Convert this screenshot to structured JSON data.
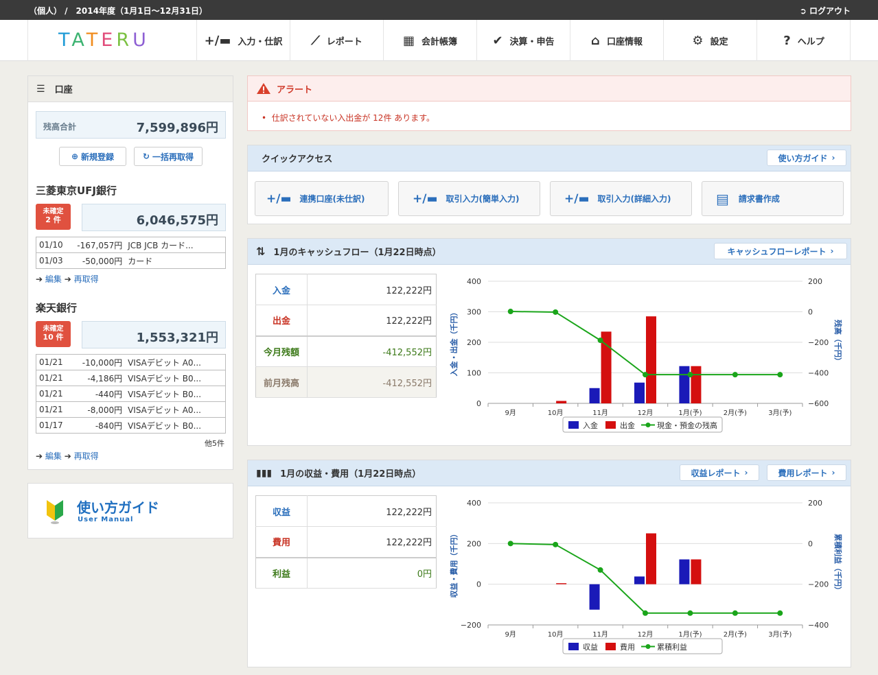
{
  "topbar": {
    "context": "（個人） /　2014年度（1月1日〜12月31日）",
    "logout": "ログアウト"
  },
  "logo": "TATERU",
  "nav": [
    {
      "label": "入力・仕訳",
      "icon": "entry-icon"
    },
    {
      "label": "レポート",
      "icon": "chart-line-icon"
    },
    {
      "label": "会計帳簿",
      "icon": "ledger-grid-icon"
    },
    {
      "label": "決算・申告",
      "icon": "check-icon"
    },
    {
      "label": "口座情報",
      "icon": "home-icon"
    },
    {
      "label": "設定",
      "icon": "gear-icon"
    },
    {
      "label": "ヘルプ",
      "icon": "question-icon"
    }
  ],
  "accounts": {
    "title": "口座",
    "total_label": "残高合計",
    "total_value": "7,599,896円",
    "new_btn": "新規登録",
    "refetch_all_btn": "一括再取得",
    "banks": [
      {
        "name": "三菱東京UFJ銀行",
        "badge_line1": "未確定",
        "badge_line2": "2 件",
        "balance": "6,046,575円",
        "rows": [
          [
            "01/10",
            "-167,057円",
            "JCB JCB カード..."
          ],
          [
            "01/03",
            "-50,000円",
            "カード"
          ]
        ],
        "more": "",
        "edit": "編集",
        "refetch": "再取得"
      },
      {
        "name": "楽天銀行",
        "badge_line1": "未確定",
        "badge_line2": "10 件",
        "balance": "1,553,321円",
        "rows": [
          [
            "01/21",
            "-10,000円",
            "VISAデビット A0..."
          ],
          [
            "01/21",
            "-4,186円",
            "VISAデビット B0..."
          ],
          [
            "01/21",
            "-440円",
            "VISAデビット B0..."
          ],
          [
            "01/21",
            "-8,000円",
            "VISAデビット A0..."
          ],
          [
            "01/17",
            "-840円",
            "VISAデビット B0..."
          ]
        ],
        "more": "他5件",
        "edit": "編集",
        "refetch": "再取得"
      }
    ]
  },
  "guide": {
    "title": "使い方ガイド",
    "subtitle": "User Manual"
  },
  "alert": {
    "title": "アラート",
    "message": "仕訳されていない入出金が 12件 あります。"
  },
  "quick": {
    "title": "クイックアクセス",
    "guide_btn": "使い方ガイド",
    "buttons": [
      "連携口座(未仕訳)",
      "取引入力(簡単入力)",
      "取引入力(詳細入力)",
      "請求書作成"
    ]
  },
  "cashflow": {
    "title": "1月のキャッシュフロー（1月22日時点）",
    "report_btn": "キャッシュフローレポート",
    "rows": [
      {
        "label": "入金",
        "value": "122,222円"
      },
      {
        "label": "出金",
        "value": "122,222円"
      },
      {
        "label": "今月残額",
        "value": "-412,552円"
      },
      {
        "label": "前月残高",
        "value": "-412,552円"
      }
    ]
  },
  "pl": {
    "title": "1月の収益・費用（1月22日時点）",
    "revenue_btn": "収益レポート",
    "expense_btn": "費用レポート",
    "rows": [
      {
        "label": "収益",
        "value": "122,222円"
      },
      {
        "label": "費用",
        "value": "122,222円"
      },
      {
        "label": "利益",
        "value": "0円"
      }
    ]
  },
  "colors": {
    "blue": "#1a1ab8",
    "red": "#d40f0f",
    "green": "#1aa51a",
    "link": "#2a6ebb"
  },
  "chart_data": [
    {
      "type": "bar",
      "categories": [
        "9月",
        "10月",
        "11月",
        "12月",
        "1月(予)",
        "2月(予)",
        "3月(予)"
      ],
      "series": [
        {
          "name": "入金",
          "type": "bar",
          "axis": "left",
          "values": [
            0,
            0,
            50,
            68,
            122,
            0,
            0
          ]
        },
        {
          "name": "出金",
          "type": "bar",
          "axis": "left",
          "values": [
            0,
            8,
            235,
            285,
            122,
            0,
            0
          ]
        },
        {
          "name": "現金・預金の残高",
          "type": "line",
          "axis": "right",
          "values": [
            2,
            -2,
            -187,
            -412,
            -412,
            -412,
            -412
          ]
        }
      ],
      "ylabel": "入金・出金（千円）",
      "y2label": "残高（千円）",
      "ylim": [
        0,
        400
      ],
      "yticks": [
        0,
        100,
        200,
        300,
        400
      ],
      "y2lim": [
        -600,
        200
      ],
      "y2ticks": [
        200,
        0,
        -200,
        -400,
        -600
      ],
      "y2tick_labels": [
        "200",
        "0",
        "−200",
        "−400",
        "−600"
      ],
      "legend": "bottom"
    },
    {
      "type": "bar",
      "categories": [
        "9月",
        "10月",
        "11月",
        "12月",
        "1月(予)",
        "2月(予)",
        "3月(予)"
      ],
      "series": [
        {
          "name": "収益",
          "type": "bar",
          "axis": "left",
          "values": [
            0,
            0,
            -125,
            38,
            122,
            0,
            0
          ]
        },
        {
          "name": "費用",
          "type": "bar",
          "axis": "left",
          "values": [
            0,
            5,
            0,
            250,
            122,
            0,
            0
          ]
        },
        {
          "name": "累積利益",
          "type": "line",
          "axis": "right",
          "values": [
            0,
            -5,
            -130,
            -342,
            -342,
            -342,
            -342
          ]
        }
      ],
      "ylabel": "収益・費用（千円）",
      "y2label": "累積利益（千円）",
      "ylim": [
        -200,
        400
      ],
      "yticks": [
        -200,
        0,
        200,
        400
      ],
      "ytick_labels": [
        "−200",
        "0",
        "200",
        "400"
      ],
      "y2lim": [
        -400,
        200
      ],
      "y2ticks": [
        200,
        0,
        -200,
        -400
      ],
      "y2tick_labels": [
        "200",
        "0",
        "−200",
        "−400"
      ],
      "legend": "bottom"
    }
  ]
}
